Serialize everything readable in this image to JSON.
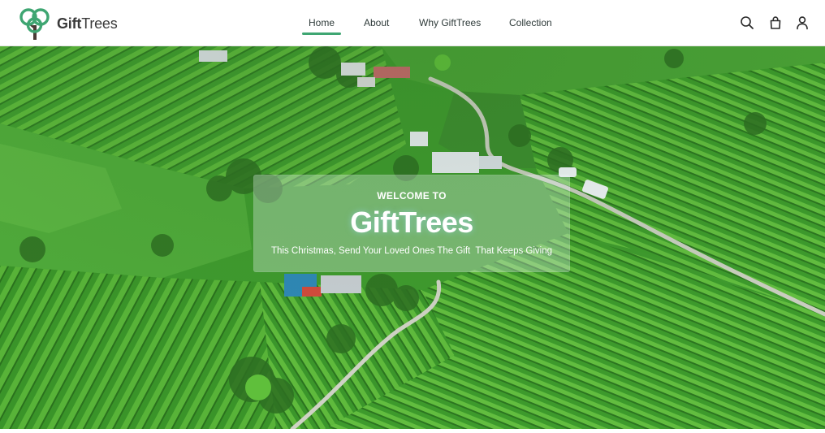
{
  "brand": {
    "name_bold": "Gift",
    "name_light": "Trees",
    "logo_icon": "tree-logo-icon",
    "accent_color": "#3fa672"
  },
  "nav": {
    "items": [
      {
        "label": "Home",
        "active": true
      },
      {
        "label": "About",
        "active": false
      },
      {
        "label": "Why GiftTrees",
        "active": false
      },
      {
        "label": "Collection",
        "active": false
      }
    ]
  },
  "header_icons": {
    "search": "search-icon",
    "cart": "shopping-bag-icon",
    "account": "user-icon"
  },
  "hero": {
    "kicker": "WELCOME TO",
    "title": "GiftTrees",
    "tagline": "This Christmas, Send Your Loved Ones The Gift  That Keeps Giving"
  }
}
